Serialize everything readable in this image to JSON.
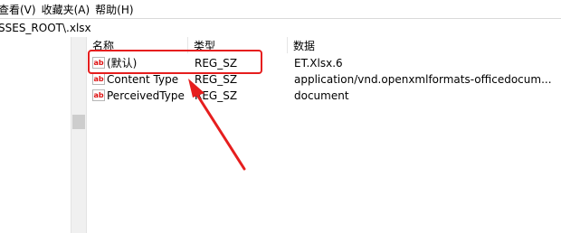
{
  "menubar": {
    "items": [
      "查看(V)",
      "收藏夹(A)",
      "帮助(H)"
    ]
  },
  "address": {
    "path": "SSES_ROOT\\.xlsx"
  },
  "list": {
    "columns": [
      "名称",
      "类型",
      "数据"
    ],
    "rows": [
      {
        "name": "(默认)",
        "type": "REG_SZ",
        "data": "ET.Xlsx.6"
      },
      {
        "name": "Content Type",
        "type": "REG_SZ",
        "data": "application/vnd.openxmlformats-officedocum..."
      },
      {
        "name": "PerceivedType",
        "type": "REG_SZ",
        "data": "document"
      }
    ]
  },
  "icons": {
    "value": "ab-string-icon"
  },
  "colors": {
    "annotation": "#e61e1e"
  }
}
